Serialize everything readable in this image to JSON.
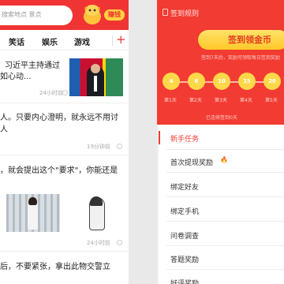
{
  "left": {
    "search_placeholder": "搜索地点 景点",
    "earn_label": "赚钱",
    "tabs": [
      "笑话",
      "娱乐",
      "游戏"
    ],
    "add_tab": "+",
    "articles": [
      {
        "lines": [
          "习近平主持通过",
          "如心动..."
        ],
        "meta": "24小时前"
      },
      {
        "lines": [
          "人。只要内心澄明，就永远不用讨",
          "人"
        ],
        "meta": "19分钟前"
      },
      {
        "lines": [
          "，就会提出这个\"要求\"，你能还是"
        ],
        "meta": "24小时前"
      },
      {
        "lines": [
          "后，不要紧张，拿出此物交警立"
        ],
        "meta": ""
      }
    ]
  },
  "right": {
    "title": "签到规则",
    "sign_button": "签到领金币",
    "subtitle": "签到7天后，奖励可领取每日签到奖励",
    "coins": [
      "4",
      "6",
      "10",
      "15",
      "20"
    ],
    "days": [
      "第1天",
      "第2天",
      "第3天",
      "第4天",
      "第5天"
    ],
    "footer": "已连续签到0天",
    "tasks": [
      "新手任务",
      "首次提现奖励",
      "绑定好友",
      "绑定手机",
      "问卷调查",
      "答题奖励",
      "好评奖励"
    ]
  },
  "colors": {
    "brand_red": "#f03434",
    "gold": "#ffd23f"
  }
}
